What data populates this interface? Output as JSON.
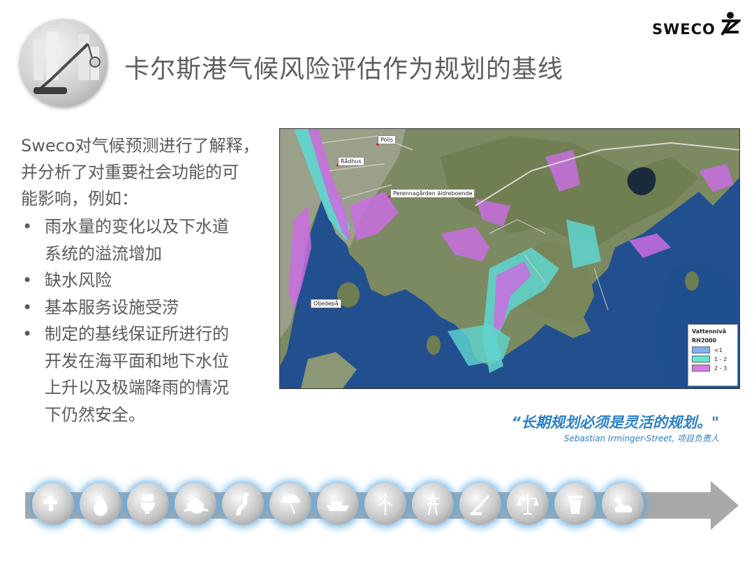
{
  "header": {
    "title": "卡尔斯港气候风险评估作为规划的基线",
    "logo_text": "SWECO",
    "badge_icon": "crane-city-icon",
    "logo_icon": "sweco-figure-icon"
  },
  "body": {
    "intro": [
      "Sweco对气候预测进行了解释，",
      "并分析了对重要社会功能的可",
      "能影响，例如："
    ],
    "bullet_symbol": "•",
    "bullets": [
      [
        "雨水量的变化以及下水道",
        "系统的溢流增加"
      ],
      [
        "缺水风险"
      ],
      [
        "基本服务设施受涝"
      ],
      [
        "制定的基线保证所进行的",
        "开发在海平面和地下水位",
        "上升以及极端降雨的情况",
        "下仍然安全。"
      ]
    ]
  },
  "map": {
    "labels": {
      "polis": "Polis",
      "radhus": "Rådhus",
      "perenna": "Perennagården äldreboende",
      "oljedepa": "Oljedepå"
    },
    "legend": {
      "title": "Vattennivå",
      "subtitle": "RH2000",
      "items": [
        {
          "label": "<1",
          "color": "#7fb2ee"
        },
        {
          "label": "1 - 2",
          "color": "#66e6d2"
        },
        {
          "label": "2 - 3",
          "color": "#d77be8"
        }
      ]
    }
  },
  "quote": {
    "text": "“长期规划必须是灵活的规划。\"",
    "author": "Sebastian Irminger-Street, 项目负责人"
  },
  "icon_strip": {
    "icons": [
      "faucet-icon",
      "water-drop-icon",
      "toilet-icon",
      "flood-house-icon",
      "road-icon",
      "beach-umbrella-icon",
      "ship-icon",
      "wind-turbine-icon",
      "power-pylon-icon",
      "crane-icon",
      "scales-icon",
      "trash-bin-icon",
      "swan-icon"
    ],
    "glow_color": "#5aaae6"
  },
  "colors": {
    "title": "#5e5e5e",
    "text": "#5a5a5a",
    "quote": "#2a7fc7",
    "water": "#1f4f8f",
    "strip": "#a9a9a9"
  }
}
